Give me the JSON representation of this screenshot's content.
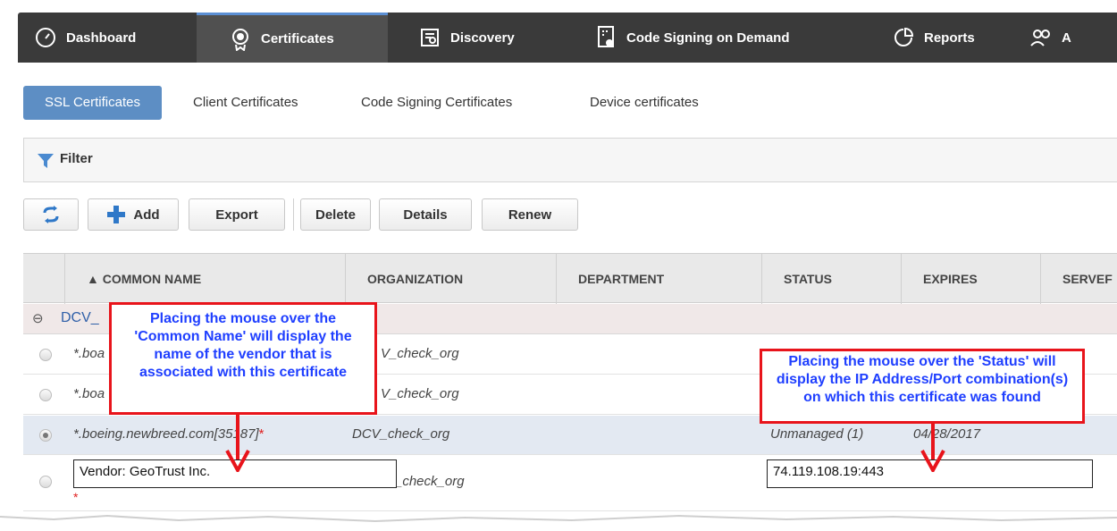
{
  "nav": {
    "tabs": [
      {
        "label": "Dashboard",
        "icon": "gauge-icon"
      },
      {
        "label": "Certificates",
        "icon": "certificate-icon"
      },
      {
        "label": "Discovery",
        "icon": "discovery-icon"
      },
      {
        "label": "Code Signing on Demand",
        "icon": "code-signing-icon"
      },
      {
        "label": "Reports",
        "icon": "reports-icon"
      },
      {
        "label": "A",
        "icon": "admins-icon"
      }
    ],
    "active": "Certificates"
  },
  "subtabs": [
    {
      "label": "SSL Certificates",
      "active": true
    },
    {
      "label": "Client Certificates"
    },
    {
      "label": "Code Signing Certificates"
    },
    {
      "label": "Device certificates"
    }
  ],
  "filter": {
    "label": "Filter"
  },
  "toolbar": {
    "add_label": "Add",
    "export_label": "Export",
    "delete_label": "Delete",
    "details_label": "Details",
    "renew_label": "Renew"
  },
  "table": {
    "columns": [
      "▲ COMMON NAME",
      "ORGANIZATION",
      "DEPARTMENT",
      "STATUS",
      "EXPIRES",
      "SERVEF"
    ],
    "group_label": "DCV_",
    "rows": [
      {
        "common_name": "*.boa",
        "organization": "V_check_org"
      },
      {
        "common_name": "*.boa",
        "organization": "V_check_org"
      },
      {
        "common_name": "*.boeing.newbreed.com[35187]",
        "required_mark": "*",
        "organization": "DCV_check_org",
        "status": "Unmanaged (1)",
        "expires": "04/28/2017",
        "selected": true
      },
      {
        "organization": "_check_org",
        "required_mark": "*"
      }
    ]
  },
  "callouts": {
    "common_name": "Placing the mouse over the 'Common Name' will display the name of the vendor that is associated with this certificate",
    "status": "Placing the mouse over the 'Status' will display the IP Address/Port combination(s) on which this certificate was found"
  },
  "tooltips": {
    "vendor": "Vendor: GeoTrust Inc.",
    "ip_port": "74.119.108.19:443"
  },
  "colors": {
    "nav_bg": "#3a3a3a",
    "active_subtab": "#5d8ec4",
    "callout_border": "#e8141b",
    "callout_text": "#1f3fff"
  }
}
